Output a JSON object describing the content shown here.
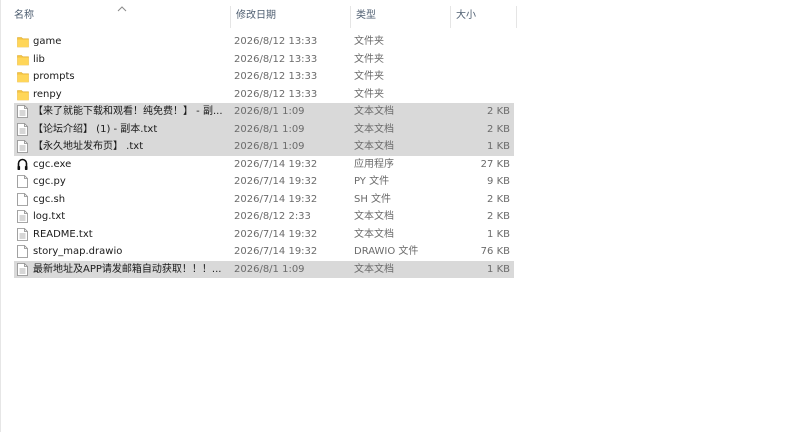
{
  "header": {
    "name_label": "名称",
    "date_label": "修改日期",
    "type_label": "类型",
    "size_label": "大小"
  },
  "files": [
    {
      "name": "game",
      "date": "2026/8/12 13:33",
      "type": "文件夹",
      "size": "",
      "icon": "folder-icon",
      "selected": false
    },
    {
      "name": "lib",
      "date": "2026/8/12 13:33",
      "type": "文件夹",
      "size": "",
      "icon": "folder-icon",
      "selected": false
    },
    {
      "name": "prompts",
      "date": "2026/8/12 13:33",
      "type": "文件夹",
      "size": "",
      "icon": "folder-icon",
      "selected": false
    },
    {
      "name": "renpy",
      "date": "2026/8/12 13:33",
      "type": "文件夹",
      "size": "",
      "icon": "folder-icon",
      "selected": false
    },
    {
      "name": "【来了就能下载和观看！纯免费！】 - 副...",
      "date": "2026/8/1 1:09",
      "type": "文本文档",
      "size": "2 KB",
      "icon": "text-file-icon",
      "selected": true
    },
    {
      "name": "【论坛介绍】 (1) - 副本.txt",
      "date": "2026/8/1 1:09",
      "type": "文本文档",
      "size": "2 KB",
      "icon": "text-file-icon",
      "selected": true
    },
    {
      "name": "【永久地址发布页】 .txt",
      "date": "2026/8/1 1:09",
      "type": "文本文档",
      "size": "1 KB",
      "icon": "text-file-icon",
      "selected": true
    },
    {
      "name": "cgc.exe",
      "date": "2026/7/14 19:32",
      "type": "应用程序",
      "size": "27 KB",
      "icon": "app-exe-icon",
      "selected": false
    },
    {
      "name": "cgc.py",
      "date": "2026/7/14 19:32",
      "type": "PY 文件",
      "size": "9 KB",
      "icon": "file-icon",
      "selected": false
    },
    {
      "name": "cgc.sh",
      "date": "2026/7/14 19:32",
      "type": "SH 文件",
      "size": "2 KB",
      "icon": "file-icon",
      "selected": false
    },
    {
      "name": "log.txt",
      "date": "2026/8/12 2:33",
      "type": "文本文档",
      "size": "2 KB",
      "icon": "text-file-icon",
      "selected": false
    },
    {
      "name": "README.txt",
      "date": "2026/7/14 19:32",
      "type": "文本文档",
      "size": "1 KB",
      "icon": "text-file-icon",
      "selected": false
    },
    {
      "name": "story_map.drawio",
      "date": "2026/7/14 19:32",
      "type": "DRAWIO 文件",
      "size": "76 KB",
      "icon": "file-icon",
      "selected": false
    },
    {
      "name": "最新地址及APP请发邮箱自动获取！！！...",
      "date": "2026/8/1 1:09",
      "type": "文本文档",
      "size": "1 KB",
      "icon": "text-file-icon",
      "selected": true
    }
  ],
  "colors": {
    "folder": "#f5c542",
    "selected_row": "#d9d9d9",
    "header_text": "#4d5d70"
  }
}
